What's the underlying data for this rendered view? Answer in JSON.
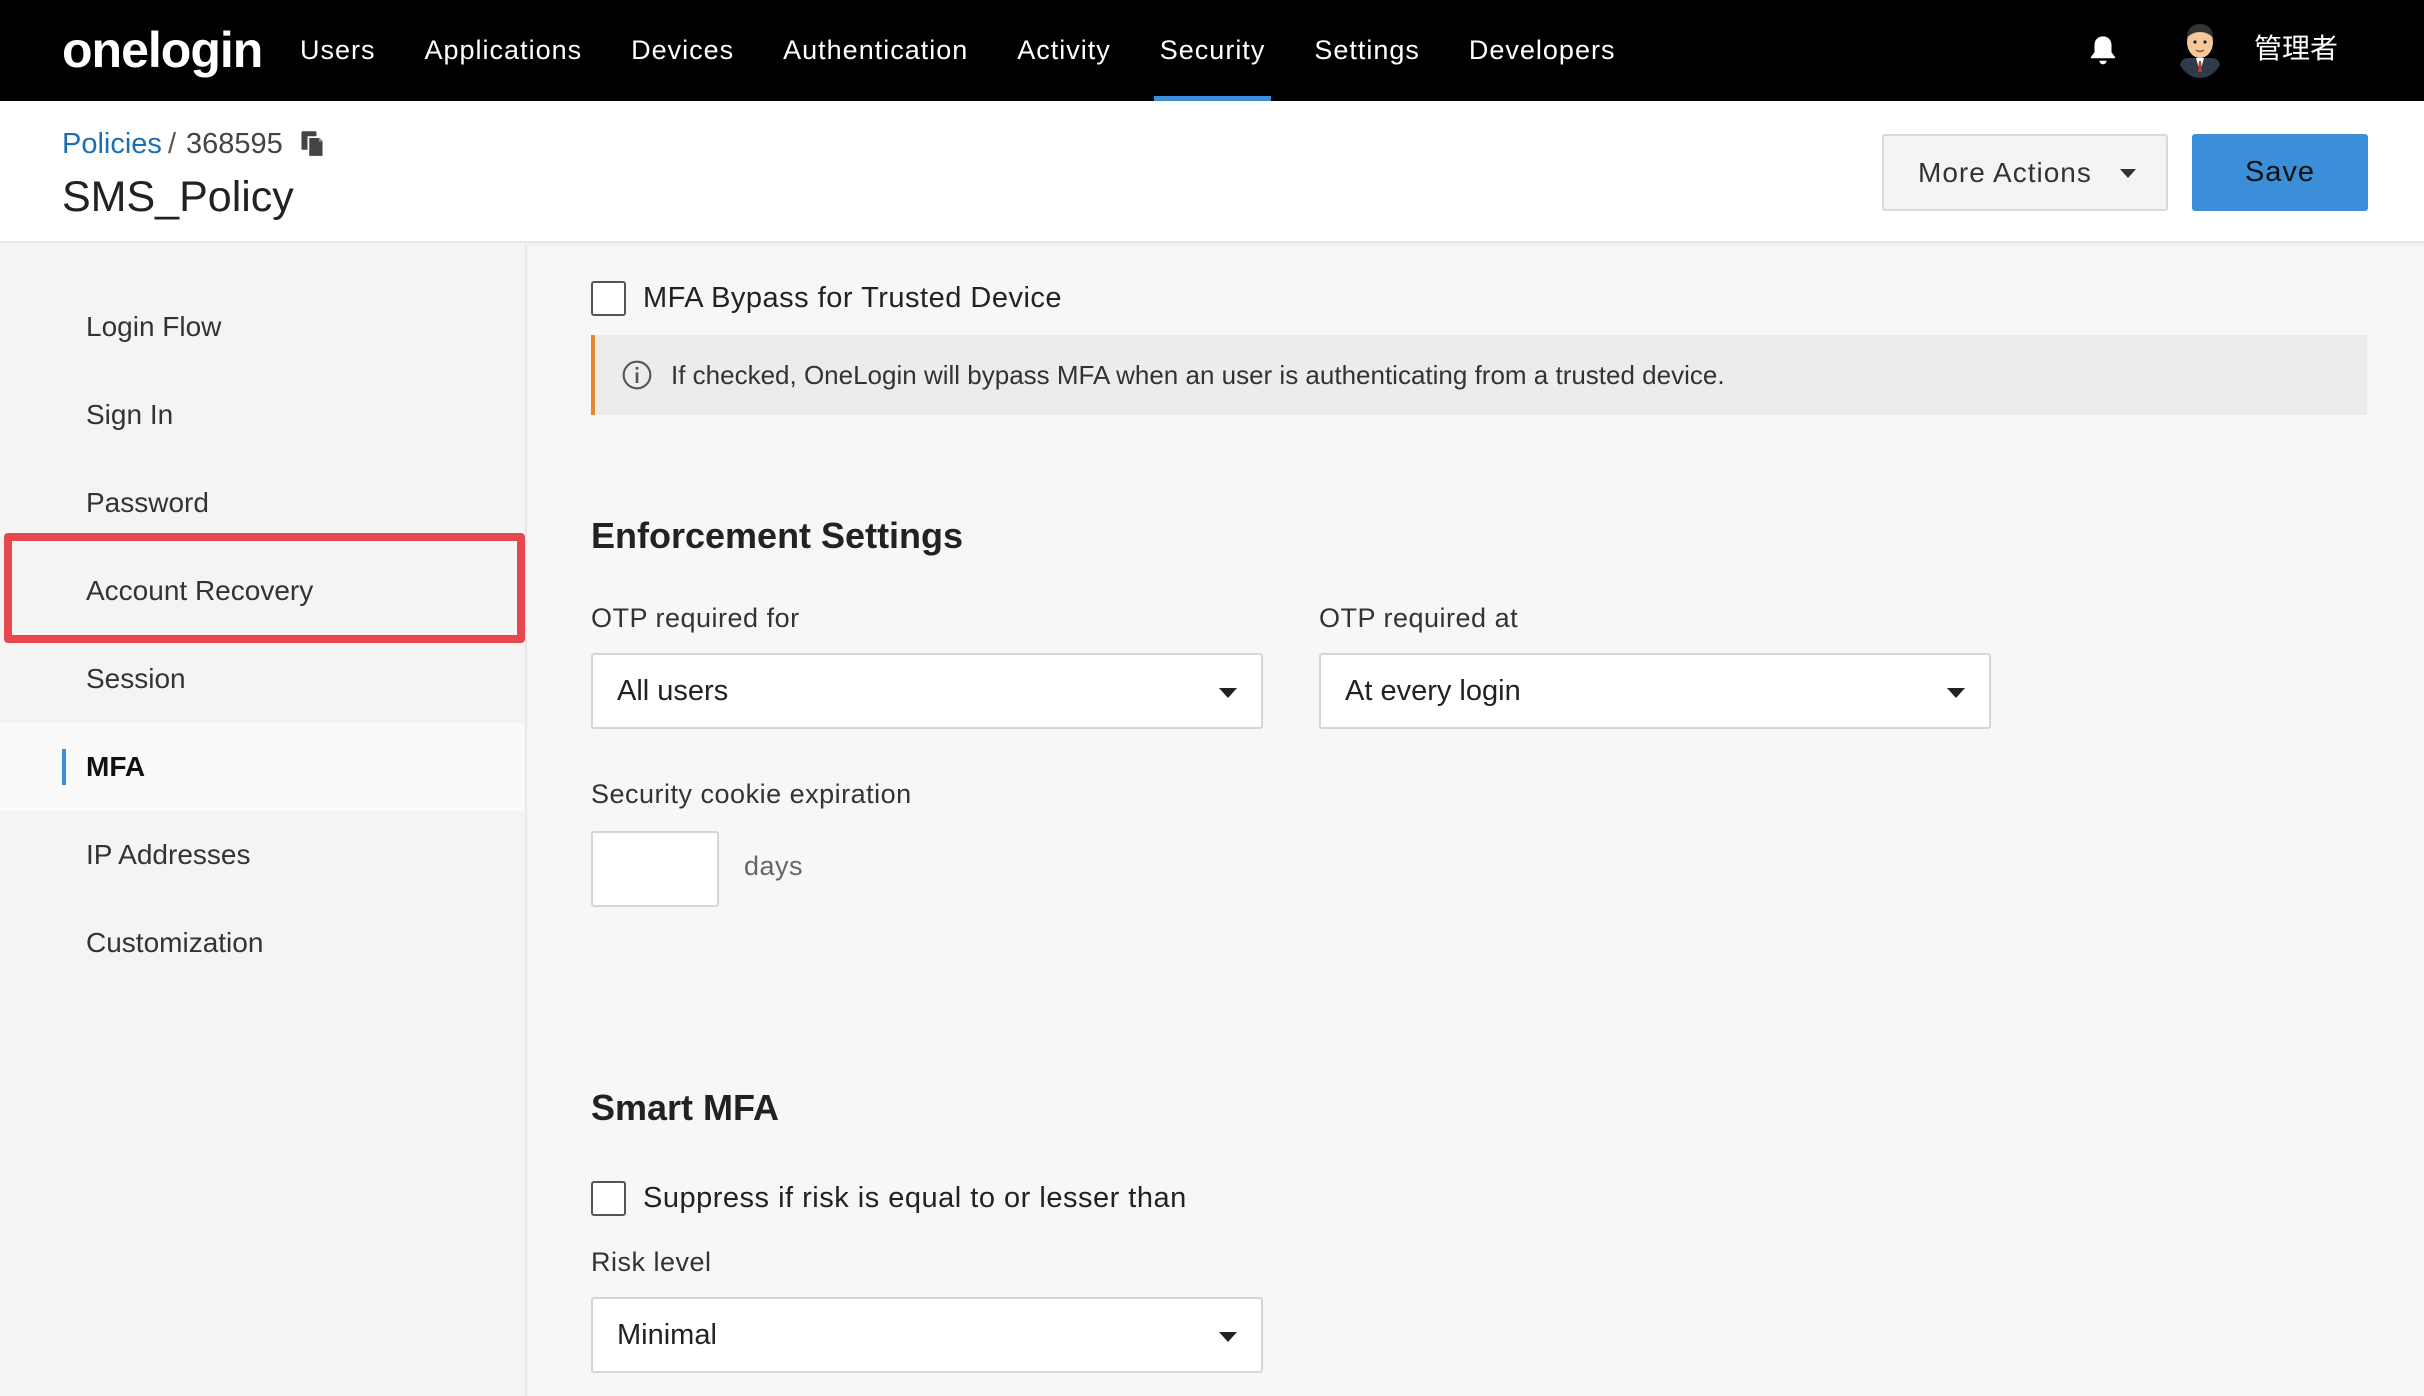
{
  "topnav": {
    "logo": "onelogin",
    "items": [
      {
        "label": "Users"
      },
      {
        "label": "Applications"
      },
      {
        "label": "Devices"
      },
      {
        "label": "Authentication"
      },
      {
        "label": "Activity"
      },
      {
        "label": "Security",
        "active": true
      },
      {
        "label": "Settings"
      },
      {
        "label": "Developers"
      }
    ],
    "notifications_icon": "bell-icon",
    "user_name": "管理者"
  },
  "header": {
    "breadcrumb_link": "Policies",
    "breadcrumb_sep": "/",
    "policy_id": "368595",
    "title": "SMS_Policy",
    "more_actions_label": "More Actions",
    "save_label": "Save"
  },
  "sidebar": {
    "items": [
      {
        "label": "Login Flow"
      },
      {
        "label": "Sign In"
      },
      {
        "label": "Password"
      },
      {
        "label": "Account Recovery",
        "highlighted": true
      },
      {
        "label": "Session"
      },
      {
        "label": "MFA",
        "active": true
      },
      {
        "label": "IP Addresses"
      },
      {
        "label": "Customization"
      }
    ]
  },
  "main": {
    "mfa_bypass_label": "MFA Bypass for Trusted Device",
    "mfa_bypass_checked": false,
    "mfa_bypass_info": "If checked, OneLogin will bypass MFA when an user is authenticating from a trusted device.",
    "enforcement": {
      "title": "Enforcement Settings",
      "otp_for_label": "OTP required for",
      "otp_for_value": "All users",
      "otp_at_label": "OTP required at",
      "otp_at_value": "At every login",
      "cookie_label": "Security cookie expiration",
      "cookie_value": "",
      "cookie_unit": "days"
    },
    "smart_mfa": {
      "title": "Smart MFA",
      "suppress_label": "Suppress if risk is equal to or lesser than",
      "suppress_checked": false,
      "risk_label": "Risk level",
      "risk_value": "Minimal"
    }
  },
  "colors": {
    "accent": "#3a8fd8",
    "highlight": "#e5484d",
    "info_border": "#e08a2e"
  }
}
